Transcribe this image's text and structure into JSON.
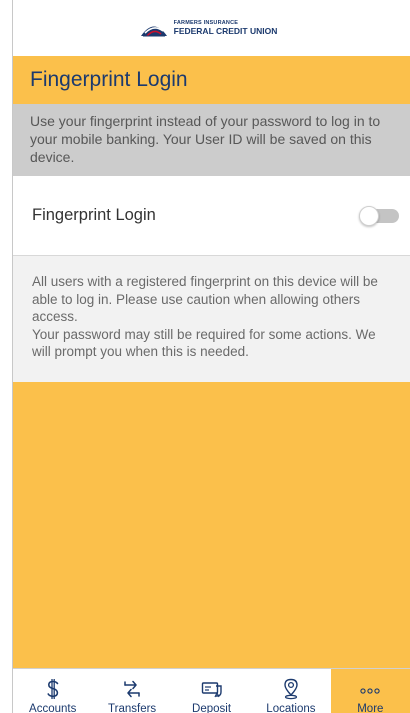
{
  "brand": {
    "line1": "FARMERS INSURANCE",
    "line2": "FEDERAL CREDIT UNION"
  },
  "page": {
    "title": "Fingerprint Login",
    "intro": "Use your fingerprint instead of your password to log in to your mobile banking. Your User ID will be saved on this device."
  },
  "setting": {
    "label": "Fingerprint Login",
    "enabled": false
  },
  "notes": {
    "line1": "All users with a registered fingerprint on this device will be able to log in. Please use caution when allowing others access.",
    "line2": "Your password may still be required for some actions. We will prompt you when this is needed."
  },
  "tabs": [
    {
      "label": "Accounts",
      "icon": "dollar-icon"
    },
    {
      "label": "Transfers",
      "icon": "transfer-arrows-icon"
    },
    {
      "label": "Deposit",
      "icon": "check-deposit-icon"
    },
    {
      "label": "Locations",
      "icon": "map-pin-icon"
    },
    {
      "label": "More",
      "icon": "more-dots-icon",
      "active": true
    }
  ],
  "colors": {
    "accent": "#fbc04b",
    "navy": "#1c3a6e",
    "intro_bg": "#cccccc",
    "notes_bg": "#f2f2f2"
  }
}
